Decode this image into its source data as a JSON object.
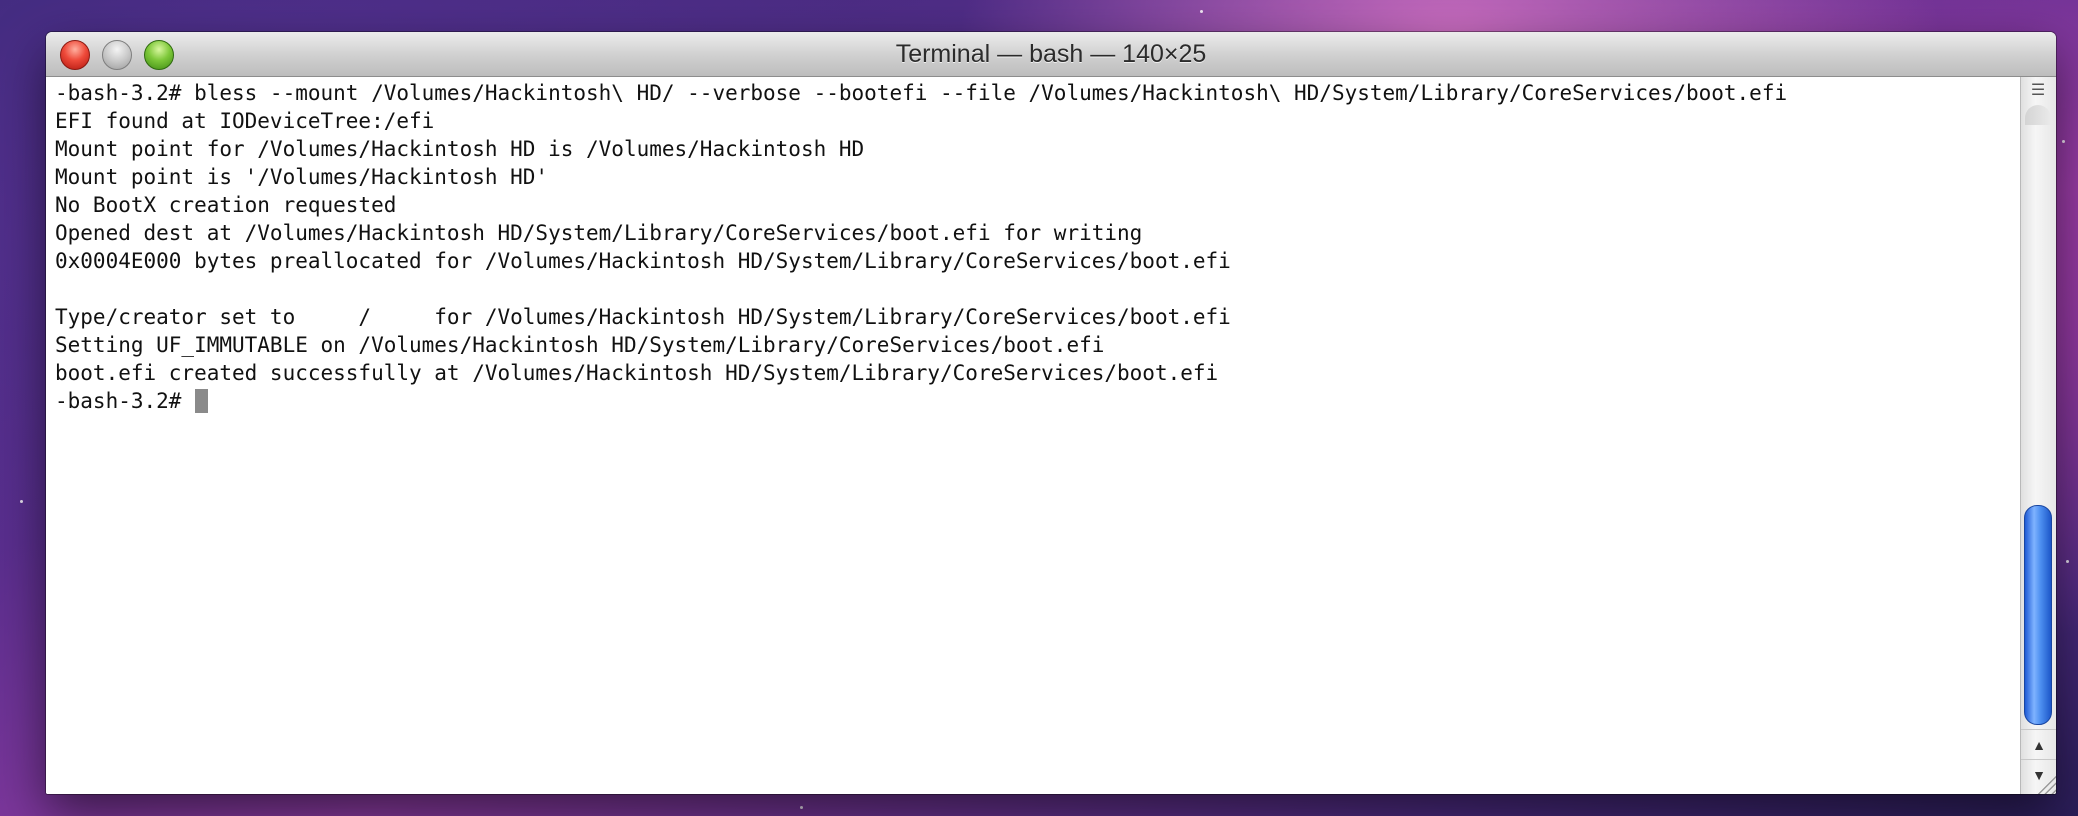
{
  "window": {
    "title": "Terminal — bash — 140×25",
    "buttons": {
      "close": "close-icon",
      "minimize": "minimize-icon",
      "zoom": "zoom-icon"
    }
  },
  "terminal": {
    "lines": [
      "-bash-3.2# bless --mount /Volumes/Hackintosh\\ HD/ --verbose --bootefi --file /Volumes/Hackintosh\\ HD/System/Library/CoreServices/boot.efi",
      "EFI found at IODeviceTree:/efi",
      "Mount point for /Volumes/Hackintosh HD is /Volumes/Hackintosh HD",
      "Mount point is '/Volumes/Hackintosh HD'",
      "No BootX creation requested",
      "Opened dest at /Volumes/Hackintosh HD/System/Library/CoreServices/boot.efi for writing",
      "0x0004E000 bytes preallocated for /Volumes/Hackintosh HD/System/Library/CoreServices/boot.efi",
      "",
      "Type/creator set to     /     for /Volumes/Hackintosh HD/System/Library/CoreServices/boot.efi",
      "Setting UF_IMMUTABLE on /Volumes/Hackintosh HD/System/Library/CoreServices/boot.efi",
      "boot.efi created successfully at /Volumes/Hackintosh HD/System/Library/CoreServices/boot.efi"
    ],
    "prompt": "-bash-3.2# "
  },
  "scrollbar": {
    "split_icon": "split-pane-icon",
    "up_arrow": "▲",
    "down_arrow": "▼"
  },
  "colors": {
    "thumb": "#3b7ee8",
    "close": "#ee4a3a",
    "zoom": "#7ec83a"
  }
}
